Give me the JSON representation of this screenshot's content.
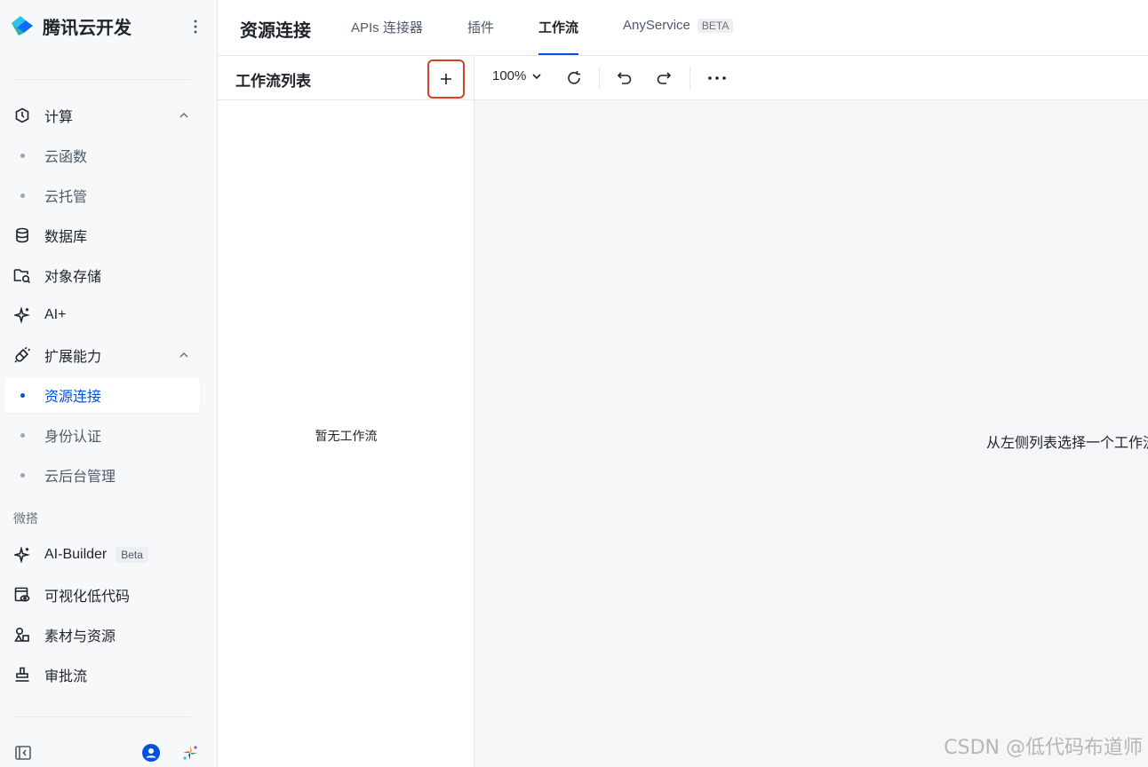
{
  "brand": {
    "name": "腾讯云开发"
  },
  "sidebar": {
    "groups": [
      {
        "label": "计算",
        "subs": [
          "云函数",
          "云托管"
        ]
      },
      {
        "label": "数据库"
      },
      {
        "label": "对象存储"
      },
      {
        "label": "AI+"
      },
      {
        "label": "扩展能力",
        "subs": [
          "资源连接",
          "身份认证",
          "云后台管理"
        ]
      }
    ],
    "section_weda": "微搭",
    "weda_items": [
      {
        "label": "AI-Builder",
        "badge": "Beta"
      },
      {
        "label": "可视化低代码"
      },
      {
        "label": "素材与资源"
      },
      {
        "label": "审批流"
      }
    ],
    "active": "资源连接"
  },
  "topbar": {
    "title": "资源连接",
    "tabs": [
      "APIs 连接器",
      "插件",
      "工作流",
      "AnyService"
    ],
    "active_tab": "工作流",
    "anyservice_badge": "BETA"
  },
  "listpanel": {
    "title": "工作流列表",
    "empty": "暂无工作流"
  },
  "toolbar": {
    "zoom": "100%"
  },
  "canvas": {
    "hint": "从左侧列表选择一个工作流"
  },
  "watermark": "CSDN @低代码布道师",
  "colors": {
    "accent": "#0052d9",
    "highlight_border": "#d14424",
    "canvas_bg": "#f5f6f7"
  }
}
